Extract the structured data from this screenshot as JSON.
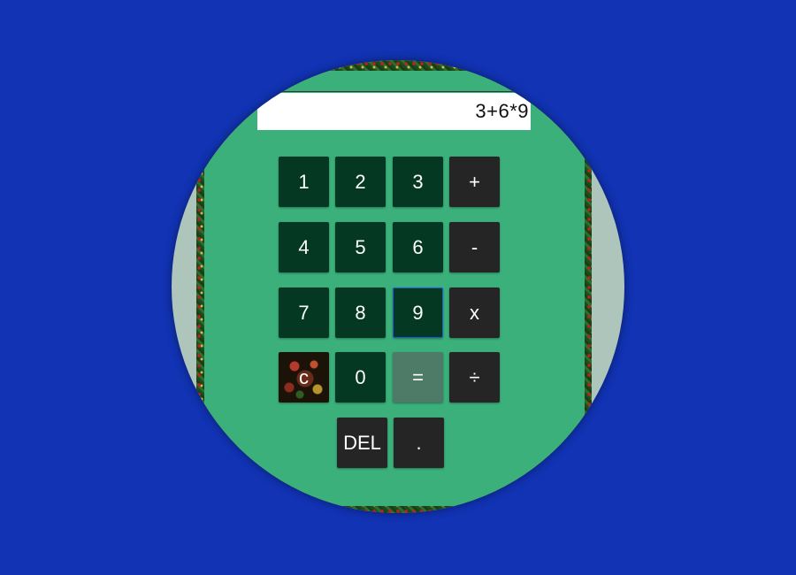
{
  "calculator": {
    "display": "3+6*9",
    "keys": {
      "k1": "1",
      "k2": "2",
      "k3": "3",
      "plus": "+",
      "k4": "4",
      "k5": "5",
      "k6": "6",
      "minus": "-",
      "k7": "7",
      "k8": "8",
      "k9": "9",
      "multiply": "x",
      "clear": "c",
      "k0": "0",
      "equals": "=",
      "divide": "÷",
      "delete": "DEL",
      "decimal": "."
    }
  },
  "colors": {
    "background": "#1133b4",
    "panel": "#3bb07b",
    "number_key": "#043822",
    "operator_key": "#252525",
    "equals_key": "#4e7b67"
  }
}
